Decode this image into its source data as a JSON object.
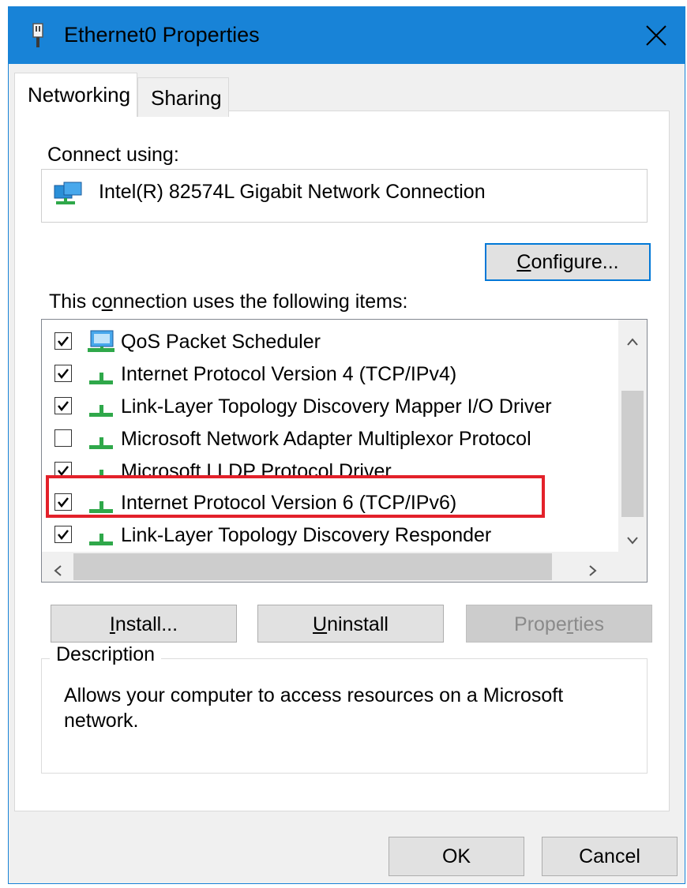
{
  "window": {
    "title": "Ethernet0 Properties",
    "accent_color": "#1883d7",
    "title_icon": "network-adapter-icon",
    "close_icon": "close-icon"
  },
  "tabs": [
    {
      "label": "Networking",
      "active": true
    },
    {
      "label": "Sharing",
      "active": false
    }
  ],
  "connect_using": {
    "label": "Connect using:",
    "adapter_icon": "network-adapter-icon",
    "adapter_name": "Intel(R) 82574L Gigabit Network Connection"
  },
  "buttons": {
    "configure": {
      "pre": "",
      "key": "C",
      "post": "onfigure..."
    },
    "install": {
      "pre": "",
      "key": "I",
      "post": "nstall..."
    },
    "uninstall": {
      "pre": "",
      "key": "U",
      "post": "ninstall"
    },
    "properties": {
      "pre": "Prope",
      "key": "r",
      "post": "ties",
      "disabled": true
    },
    "ok": "OK",
    "cancel": "Cancel"
  },
  "items_section": {
    "label_pre": "This c",
    "label_key": "o",
    "label_post": "nnection uses the following items:"
  },
  "items": [
    {
      "label": "QoS Packet Scheduler",
      "checked": true,
      "icon": "network-client-icon"
    },
    {
      "label": "Internet Protocol Version 4 (TCP/IPv4)",
      "checked": true,
      "icon": "protocol-icon"
    },
    {
      "label": "Link-Layer Topology Discovery Mapper I/O Driver",
      "checked": true,
      "icon": "protocol-icon"
    },
    {
      "label": "Microsoft Network Adapter Multiplexor Protocol",
      "checked": false,
      "icon": "protocol-icon"
    },
    {
      "label": "Microsoft LLDP Protocol Driver",
      "checked": true,
      "icon": "protocol-icon"
    },
    {
      "label": "Internet Protocol Version 6 (TCP/IPv6)",
      "checked": true,
      "icon": "protocol-icon",
      "highlighted": true
    },
    {
      "label": "Link-Layer Topology Discovery Responder",
      "checked": true,
      "icon": "protocol-icon"
    }
  ],
  "highlight_color": "#e3212a",
  "description": {
    "legend": "Description",
    "text": "Allows your computer to access resources on a Microsoft network."
  }
}
